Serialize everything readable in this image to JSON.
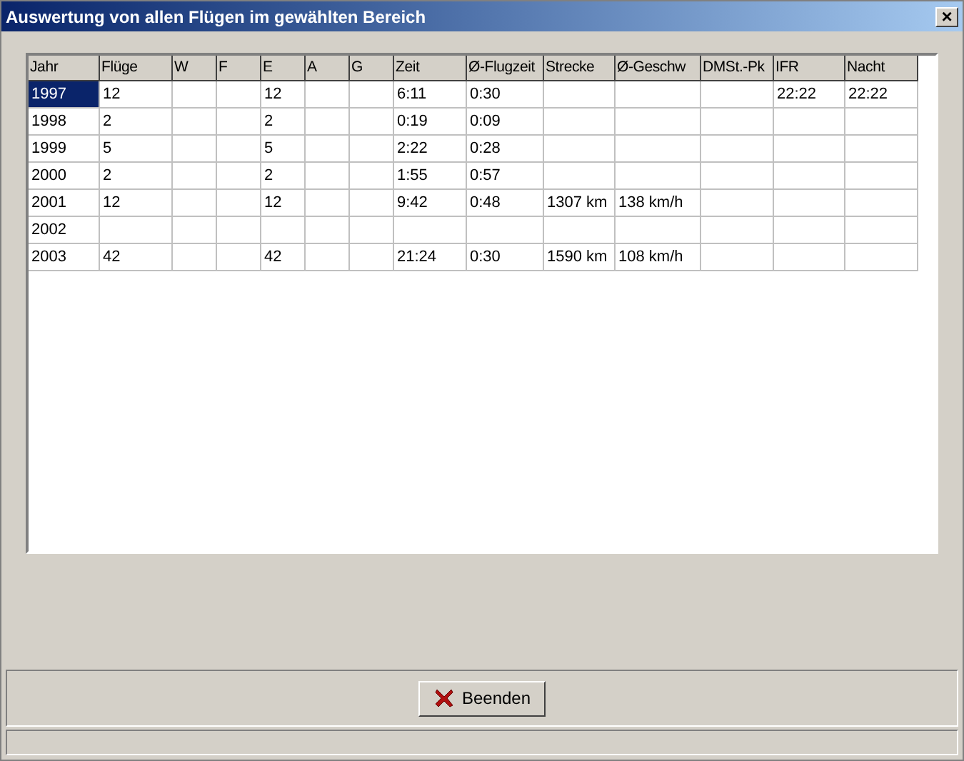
{
  "window": {
    "title": "Auswertung von allen Flügen im gewählten Bereich",
    "close": "×"
  },
  "table": {
    "columns": [
      "Jahr",
      "Flüge",
      "W",
      "F",
      "E",
      "A",
      "G",
      "Zeit",
      "Ø-Flugzeit",
      "Strecke",
      "Ø-Geschw",
      "DMSt.-Pk",
      "IFR",
      "Nacht"
    ],
    "rows": [
      {
        "selected": true,
        "cells": [
          "1997",
          "12",
          "",
          "",
          "12",
          "",
          "",
          "6:11",
          "0:30",
          "",
          "",
          "",
          "22:22",
          "22:22"
        ]
      },
      {
        "selected": false,
        "cells": [
          "1998",
          "2",
          "",
          "",
          "2",
          "",
          "",
          "0:19",
          "0:09",
          "",
          "",
          "",
          "",
          ""
        ]
      },
      {
        "selected": false,
        "cells": [
          "1999",
          "5",
          "",
          "",
          "5",
          "",
          "",
          "2:22",
          "0:28",
          "",
          "",
          "",
          "",
          ""
        ]
      },
      {
        "selected": false,
        "cells": [
          "2000",
          "2",
          "",
          "",
          "2",
          "",
          "",
          "1:55",
          "0:57",
          "",
          "",
          "",
          "",
          ""
        ]
      },
      {
        "selected": false,
        "cells": [
          "2001",
          "12",
          "",
          "",
          "12",
          "",
          "",
          "9:42",
          "0:48",
          "1307 km",
          "138 km/h",
          "",
          "",
          ""
        ]
      },
      {
        "selected": false,
        "cells": [
          "2002",
          "",
          "",
          "",
          "",
          "",
          "",
          "",
          "",
          "",
          "",
          "",
          "",
          ""
        ]
      },
      {
        "selected": false,
        "cells": [
          "2003",
          "42",
          "",
          "",
          "42",
          "",
          "",
          "21:24",
          "0:30",
          "1590 km",
          "108 km/h",
          "",
          "",
          ""
        ]
      }
    ]
  },
  "button": {
    "label": "Beenden"
  }
}
